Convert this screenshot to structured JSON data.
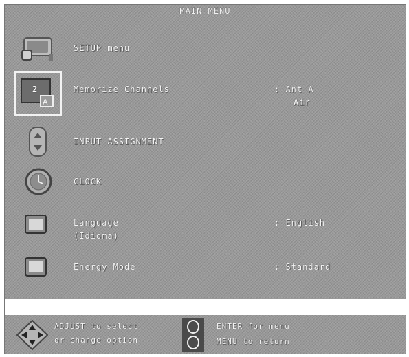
{
  "menu": {
    "title": "MAIN MENU",
    "items": [
      {
        "label": "SETUP menu",
        "value": "",
        "icon": "tv-setup-icon"
      },
      {
        "label": "Memorize Channels",
        "value": ": Ant A",
        "value2": "Air",
        "icon": "memorize-channels-icon"
      },
      {
        "label": "INPUT ASSIGNMENT",
        "value": "",
        "icon": "input-assignment-icon"
      },
      {
        "label": "CLOCK",
        "value": "",
        "icon": "clock-icon"
      },
      {
        "label": "Language",
        "label2": "(Idioma)",
        "value": ": English",
        "icon": "language-icon"
      },
      {
        "label": "Energy Mode",
        "value": ": Standard",
        "icon": "energy-mode-icon"
      }
    ]
  },
  "footer": {
    "adjust_line1": "ADJUST to select",
    "adjust_line2": "or change option",
    "enter_line1": "ENTER for menu",
    "enter_line2": "MENU to return"
  },
  "badge": "2",
  "colors": {
    "background": "#9a9a9a",
    "text": "#f5f5f5",
    "highlight": "#ffffff"
  }
}
